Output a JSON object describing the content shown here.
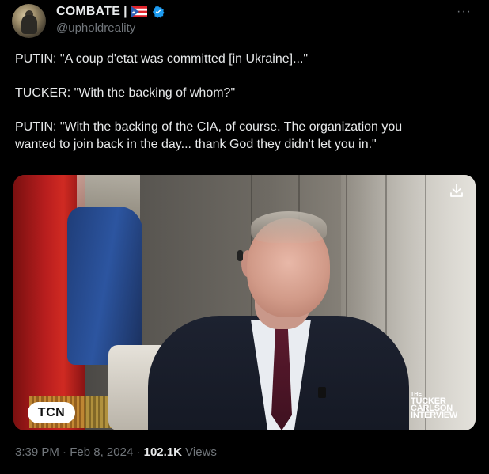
{
  "author": {
    "display_name": "COMBATE",
    "separator": "|",
    "handle": "@upholdreality",
    "avatar": "avatar-photo",
    "flag": "puerto-rico-flag-emoji",
    "verified_color": "#1d9bf0"
  },
  "more_label": "···",
  "tweet": {
    "lines": [
      "PUTIN:  \"A coup d'etat was committed [in Ukraine]...\"",
      "TUCKER:  \"With the backing of whom?\"",
      "PUTIN: \"With the backing of the CIA, of course. The organization you",
      "wanted to join back in the day... thank God they didn't let you in.\""
    ]
  },
  "media": {
    "download_icon": "download-icon",
    "watermark": "TCN",
    "brand": {
      "the": "THE",
      "line1": "TUCKER",
      "line2": "CARLSON",
      "line3": "INTERVIEW"
    }
  },
  "meta": {
    "time": "3:39 PM",
    "date": "Feb 8, 2024",
    "views_count": "102.1K",
    "views_label": "Views",
    "dot": "·"
  }
}
